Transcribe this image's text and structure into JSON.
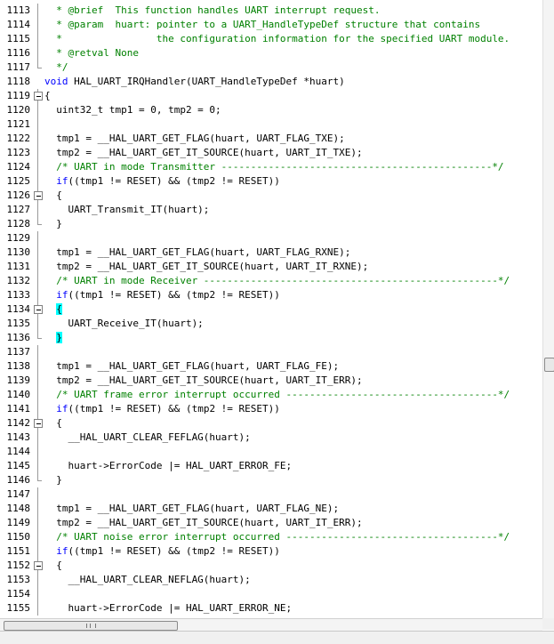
{
  "editor": {
    "lines": [
      {
        "n": "1113",
        "fold": "line",
        "segs": [
          {
            "t": "  * @brief  This function handles UART interrupt request.",
            "c": "cm"
          }
        ]
      },
      {
        "n": "1114",
        "fold": "line",
        "segs": [
          {
            "t": "  * @param  huart: pointer to a UART_HandleTypeDef structure that contains",
            "c": "cm"
          }
        ]
      },
      {
        "n": "1115",
        "fold": "line",
        "segs": [
          {
            "t": "  *                the configuration information for the specified UART module.",
            "c": "cm"
          }
        ]
      },
      {
        "n": "1116",
        "fold": "line",
        "segs": [
          {
            "t": "  * @retval None",
            "c": "cm"
          }
        ]
      },
      {
        "n": "1117",
        "fold": "end",
        "segs": [
          {
            "t": "  */",
            "c": "cm"
          }
        ]
      },
      {
        "n": "1118",
        "fold": "none",
        "segs": [
          {
            "t": "void",
            "c": "kw"
          },
          {
            "t": " HAL_UART_IRQHandler(UART_HandleTypeDef *huart)",
            "c": ""
          }
        ]
      },
      {
        "n": "1119",
        "fold": "box",
        "segs": [
          {
            "t": "{",
            "c": ""
          }
        ]
      },
      {
        "n": "1120",
        "fold": "line",
        "segs": [
          {
            "t": "  uint32_t tmp1 = 0, tmp2 = 0;",
            "c": ""
          }
        ]
      },
      {
        "n": "1121",
        "fold": "line",
        "segs": []
      },
      {
        "n": "1122",
        "fold": "line",
        "segs": [
          {
            "t": "  tmp1 = __HAL_UART_GET_FLAG(huart, UART_FLAG_TXE);",
            "c": ""
          }
        ]
      },
      {
        "n": "1123",
        "fold": "line",
        "segs": [
          {
            "t": "  tmp2 = __HAL_UART_GET_IT_SOURCE(huart, UART_IT_TXE);",
            "c": ""
          }
        ]
      },
      {
        "n": "1124",
        "fold": "line",
        "segs": [
          {
            "t": "  /* UART in mode Transmitter ----------------------------------------------*/",
            "c": "cm"
          }
        ]
      },
      {
        "n": "1125",
        "fold": "line",
        "segs": [
          {
            "t": "  ",
            "c": ""
          },
          {
            "t": "if",
            "c": "kw"
          },
          {
            "t": "((tmp1 != RESET) && (tmp2 != RESET))",
            "c": ""
          }
        ]
      },
      {
        "n": "1126",
        "fold": "box",
        "segs": [
          {
            "t": "  {",
            "c": ""
          }
        ]
      },
      {
        "n": "1127",
        "fold": "line",
        "segs": [
          {
            "t": "    UART_Transmit_IT(huart);",
            "c": ""
          }
        ]
      },
      {
        "n": "1128",
        "fold": "end",
        "segs": [
          {
            "t": "  }",
            "c": ""
          }
        ]
      },
      {
        "n": "1129",
        "fold": "line",
        "segs": []
      },
      {
        "n": "1130",
        "fold": "line",
        "segs": [
          {
            "t": "  tmp1 = __HAL_UART_GET_FLAG(huart, UART_FLAG_RXNE);",
            "c": ""
          }
        ]
      },
      {
        "n": "1131",
        "fold": "line",
        "segs": [
          {
            "t": "  tmp2 = __HAL_UART_GET_IT_SOURCE(huart, UART_IT_RXNE);",
            "c": ""
          }
        ]
      },
      {
        "n": "1132",
        "fold": "line",
        "segs": [
          {
            "t": "  /* UART in mode Receiver --------------------------------------------------*/",
            "c": "cm"
          }
        ]
      },
      {
        "n": "1133",
        "fold": "line",
        "segs": [
          {
            "t": "  ",
            "c": ""
          },
          {
            "t": "if",
            "c": "kw"
          },
          {
            "t": "((tmp1 != RESET) && (tmp2 != RESET))",
            "c": ""
          }
        ]
      },
      {
        "n": "1134",
        "fold": "box",
        "segs": [
          {
            "t": "  ",
            "c": ""
          },
          {
            "t": "{",
            "c": "hl"
          }
        ]
      },
      {
        "n": "1135",
        "fold": "line",
        "segs": [
          {
            "t": "    UART_Receive_IT(huart);",
            "c": ""
          }
        ]
      },
      {
        "n": "1136",
        "fold": "end",
        "segs": [
          {
            "t": "  ",
            "c": ""
          },
          {
            "t": "}",
            "c": "hl"
          }
        ]
      },
      {
        "n": "1137",
        "fold": "line",
        "segs": []
      },
      {
        "n": "1138",
        "fold": "line",
        "segs": [
          {
            "t": "  tmp1 = __HAL_UART_GET_FLAG(huart, UART_FLAG_FE);",
            "c": ""
          }
        ]
      },
      {
        "n": "1139",
        "fold": "line",
        "segs": [
          {
            "t": "  tmp2 = __HAL_UART_GET_IT_SOURCE(huart, UART_IT_ERR);",
            "c": ""
          }
        ]
      },
      {
        "n": "1140",
        "fold": "line",
        "segs": [
          {
            "t": "  /* UART frame error interrupt occurred ------------------------------------*/",
            "c": "cm"
          }
        ]
      },
      {
        "n": "1141",
        "fold": "line",
        "segs": [
          {
            "t": "  ",
            "c": ""
          },
          {
            "t": "if",
            "c": "kw"
          },
          {
            "t": "((tmp1 != RESET) && (tmp2 != RESET))",
            "c": ""
          }
        ]
      },
      {
        "n": "1142",
        "fold": "box",
        "segs": [
          {
            "t": "  {",
            "c": ""
          }
        ]
      },
      {
        "n": "1143",
        "fold": "line",
        "segs": [
          {
            "t": "    __HAL_UART_CLEAR_FEFLAG(huart);",
            "c": ""
          }
        ]
      },
      {
        "n": "1144",
        "fold": "line",
        "segs": []
      },
      {
        "n": "1145",
        "fold": "line",
        "segs": [
          {
            "t": "    huart->ErrorCode |= HAL_UART_ERROR_FE;",
            "c": ""
          }
        ]
      },
      {
        "n": "1146",
        "fold": "end",
        "segs": [
          {
            "t": "  }",
            "c": ""
          }
        ]
      },
      {
        "n": "1147",
        "fold": "line",
        "segs": []
      },
      {
        "n": "1148",
        "fold": "line",
        "segs": [
          {
            "t": "  tmp1 = __HAL_UART_GET_FLAG(huart, UART_FLAG_NE);",
            "c": ""
          }
        ]
      },
      {
        "n": "1149",
        "fold": "line",
        "segs": [
          {
            "t": "  tmp2 = __HAL_UART_GET_IT_SOURCE(huart, UART_IT_ERR);",
            "c": ""
          }
        ]
      },
      {
        "n": "1150",
        "fold": "line",
        "segs": [
          {
            "t": "  /* UART noise error interrupt occurred ------------------------------------*/",
            "c": "cm"
          }
        ]
      },
      {
        "n": "1151",
        "fold": "line",
        "segs": [
          {
            "t": "  ",
            "c": ""
          },
          {
            "t": "if",
            "c": "kw"
          },
          {
            "t": "((tmp1 != RESET) && (tmp2 != RESET))",
            "c": ""
          }
        ]
      },
      {
        "n": "1152",
        "fold": "box",
        "segs": [
          {
            "t": "  {",
            "c": ""
          }
        ]
      },
      {
        "n": "1153",
        "fold": "line",
        "segs": [
          {
            "t": "    __HAL_UART_CLEAR_NEFLAG(huart);",
            "c": ""
          }
        ]
      },
      {
        "n": "1154",
        "fold": "line",
        "segs": []
      },
      {
        "n": "1155",
        "fold": "line",
        "segs": [
          {
            "t": "    huart->ErrorCode |= HAL_UART_ERROR_NE;",
            "c": ""
          }
        ]
      }
    ]
  },
  "colors": {
    "comment": "#008000",
    "keyword": "#0000ff",
    "brace_match": "#00ffff",
    "background": "#ffffff"
  }
}
